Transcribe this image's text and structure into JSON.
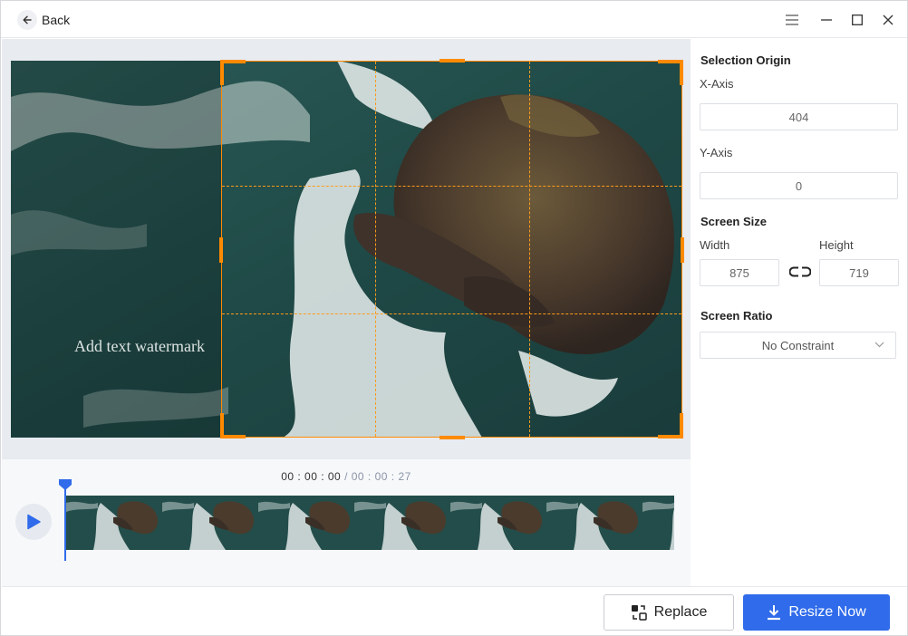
{
  "header": {
    "back_label": "Back",
    "controls": [
      "menu-icon",
      "minimize-icon",
      "maximize-icon",
      "close-icon"
    ]
  },
  "preview": {
    "watermark_text": "Add text watermark"
  },
  "timeline": {
    "current_time": "00 : 00 : 00",
    "separator": " / ",
    "total_time": "00 : 00 : 27",
    "frame_count": 7
  },
  "panel": {
    "selection_origin_title": "Selection Origin",
    "x_axis_label": "X-Axis",
    "x_axis_value": "404",
    "y_axis_label": "Y-Axis",
    "y_axis_value": "0",
    "screen_size_title": "Screen Size",
    "width_label": "Width",
    "width_value": "875",
    "height_label": "Height",
    "height_value": "719",
    "screen_ratio_title": "Screen Ratio",
    "screen_ratio_value": "No Constraint"
  },
  "footer": {
    "replace_label": "Replace",
    "resize_label": "Resize Now"
  },
  "colors": {
    "accent": "#2f6bea",
    "crop": "#ff8a00"
  }
}
